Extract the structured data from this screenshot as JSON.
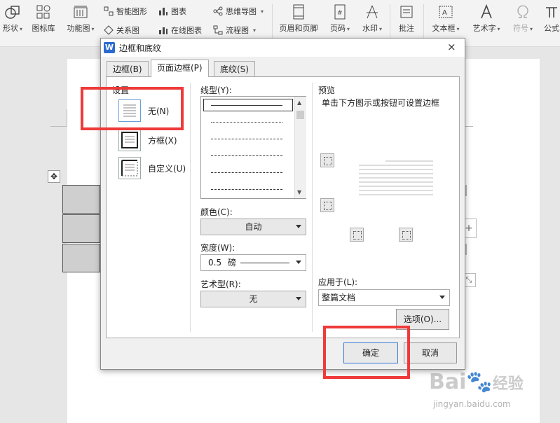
{
  "ribbon": {
    "large": [
      {
        "id": "shape",
        "label": "形状",
        "icon": "shape-icon"
      },
      {
        "id": "icon_lib",
        "label": "图标库",
        "icon": "icon-library-icon"
      },
      {
        "id": "function_chart",
        "label": "功能图",
        "icon": "function-chart-icon"
      },
      {
        "id": "header_footer",
        "label": "页眉和页脚",
        "icon": "header-footer-icon"
      },
      {
        "id": "page_number",
        "label": "页码",
        "icon": "page-number-icon"
      },
      {
        "id": "watermark",
        "label": "水印",
        "icon": "watermark-icon"
      },
      {
        "id": "annotation",
        "label": "批注",
        "icon": "annotation-icon"
      },
      {
        "id": "textbox",
        "label": "文本框",
        "icon": "textbox-icon"
      },
      {
        "id": "wordart",
        "label": "艺术字",
        "icon": "wordart-icon"
      },
      {
        "id": "symbol",
        "label": "符号",
        "icon": "symbol-icon"
      },
      {
        "id": "formula",
        "label": "公式",
        "icon": "formula-icon"
      }
    ],
    "small": [
      {
        "id": "smart_graphic",
        "label": "智能图形"
      },
      {
        "id": "chart",
        "label": "图表"
      },
      {
        "id": "mind_map",
        "label": "思维导图"
      },
      {
        "id": "relationship",
        "label": "关系图"
      },
      {
        "id": "online_chart",
        "label": "在线图表"
      },
      {
        "id": "flowchart",
        "label": "流程图"
      }
    ]
  },
  "dialog": {
    "title": "边框和底纹",
    "icon_letter": "W",
    "close": "×",
    "tabs": [
      "边框(B)",
      "页面边框(P)",
      "底纹(S)"
    ],
    "active_tab": 1,
    "settings": {
      "label": "设置",
      "options": [
        "无(N)",
        "方框(X)",
        "自定义(U)"
      ]
    },
    "line_style": {
      "label": "线型(Y):"
    },
    "color": {
      "label": "颜色(C):",
      "value": "自动"
    },
    "width": {
      "label": "宽度(W):",
      "value": "0.5",
      "unit": "磅"
    },
    "art": {
      "label": "艺术型(R):",
      "value": "无"
    },
    "preview": {
      "label": "预览",
      "hint": "单击下方图示或按钮可设置边框"
    },
    "apply_to": {
      "label": "应用于(L):",
      "value": "整篇文档"
    },
    "options_button": "选项(O)...",
    "ok_button": "确定",
    "cancel_button": "取消"
  },
  "watermark_text": {
    "brand": "Bai",
    "brand_tail": "经验",
    "url": "jingyan.baidu.com"
  },
  "colors": {
    "highlight": "#ef3a3a",
    "accent": "#2b6bd1"
  }
}
